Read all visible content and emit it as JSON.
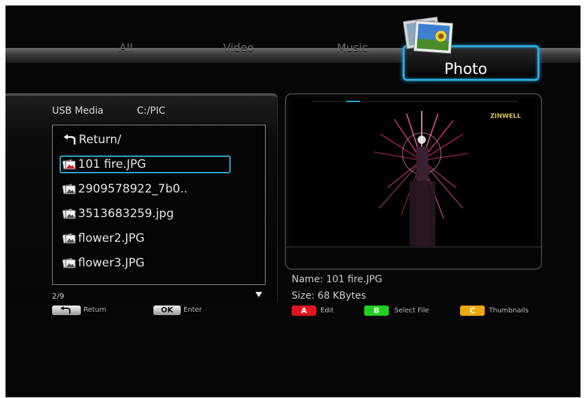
{
  "tabs": {
    "all": "All",
    "video": "Video",
    "music": "Music",
    "photo": "Photo"
  },
  "browser": {
    "source": "USB Media",
    "path": "C:/PIC",
    "items": [
      {
        "label": "Return/",
        "icon": "return-icon"
      },
      {
        "label": "101 fire.JPG",
        "icon": "photo-file-icon",
        "selected": true
      },
      {
        "label": "2909578922_7b0..",
        "icon": "photo-file-icon"
      },
      {
        "label": "3513683259.jpg",
        "icon": "photo-file-icon"
      },
      {
        "label": "flower2.JPG",
        "icon": "photo-file-icon"
      },
      {
        "label": "flower3.JPG",
        "icon": "photo-file-icon"
      }
    ],
    "page": "2/9"
  },
  "hints_left": {
    "return_label": "Return",
    "ok_key": "OK",
    "enter_label": "Enter"
  },
  "preview": {
    "watermark": "ZINWELL",
    "name_line": "Name: 101 fire.JPG",
    "size_line": "Size: 68 KBytes"
  },
  "hints_right": {
    "a_key": "A",
    "a_label": "Edit",
    "b_key": "B",
    "b_label": "Select File",
    "c_key": "C",
    "c_label": "Thumbnails"
  },
  "colors": {
    "accent": "#2aa8d8",
    "key_a": "#e0141e",
    "key_b": "#22d022",
    "key_c": "#f0a810"
  }
}
